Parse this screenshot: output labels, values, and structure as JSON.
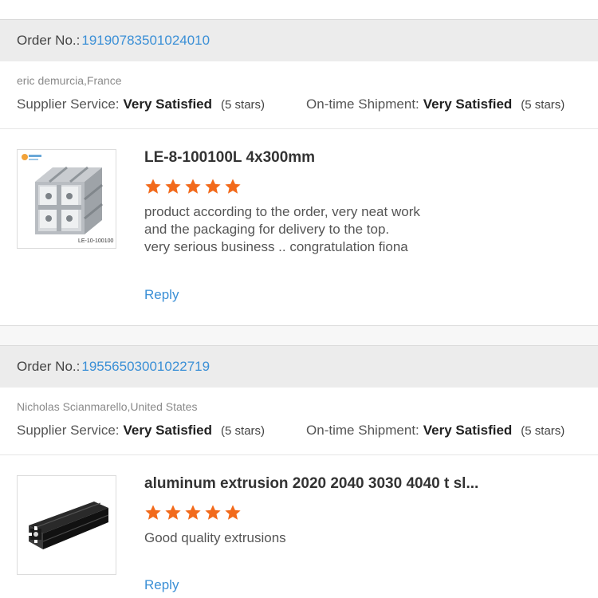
{
  "labels": {
    "order_no": "Order No.:",
    "supplier_service": "Supplier Service:",
    "ontime_shipment": "On-time Shipment:",
    "reply": "Reply"
  },
  "colors": {
    "link": "#3a8fd6",
    "star": "#f26a1b",
    "header_bg": "#ececec"
  },
  "reviews": [
    {
      "order_number": "19190783501024010",
      "buyer": "eric demurcia,France",
      "supplier_service": {
        "value": "Very Satisfied",
        "stars": "(5 stars)"
      },
      "ontime_shipment": {
        "value": "Very Satisfied",
        "stars": "(5 stars)"
      },
      "product_title": "LE-8-100100L 4x300mm",
      "rating": 5,
      "text_lines": [
        "product according to the order, very neat work",
        "and the packaging for delivery to the top.",
        "very serious business .. congratulation fiona"
      ],
      "thumb_caption": "LE-10-100100"
    },
    {
      "order_number": "19556503001022719",
      "buyer": "Nicholas Scianmarello,United States",
      "supplier_service": {
        "value": "Very Satisfied",
        "stars": "(5 stars)"
      },
      "ontime_shipment": {
        "value": "Very Satisfied",
        "stars": "(5 stars)"
      },
      "product_title": "aluminum extrusion 2020 2040 3030 4040 t sl...",
      "rating": 5,
      "text_lines": [
        "Good quality extrusions"
      ]
    }
  ]
}
